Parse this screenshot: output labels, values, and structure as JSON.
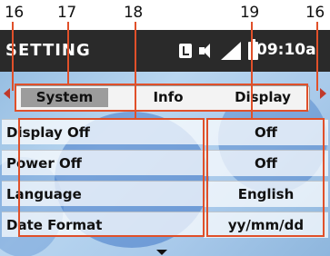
{
  "callouts": [
    "16",
    "17",
    "18",
    "19",
    "16"
  ],
  "status": {
    "title": "SETTING",
    "time": "09:10a"
  },
  "tabs": [
    {
      "label": "System",
      "active": true
    },
    {
      "label": "Info",
      "active": false
    },
    {
      "label": "Display",
      "active": false
    }
  ],
  "settings": [
    {
      "label": "Display Off",
      "value": "Off"
    },
    {
      "label": "Power Off",
      "value": "Off"
    },
    {
      "label": "Language",
      "value": "English"
    },
    {
      "label": "Date Format",
      "value": "yy/mm/dd"
    }
  ],
  "colors": {
    "highlight": "#e0502a",
    "statusbar": "#2a2a2a",
    "active_tab": "#9c9c9c"
  },
  "icons": [
    "sd-card-icon",
    "volume-icon",
    "signal-icon",
    "battery-icon",
    "scroll-left-icon",
    "scroll-right-icon",
    "scroll-down-icon"
  ]
}
